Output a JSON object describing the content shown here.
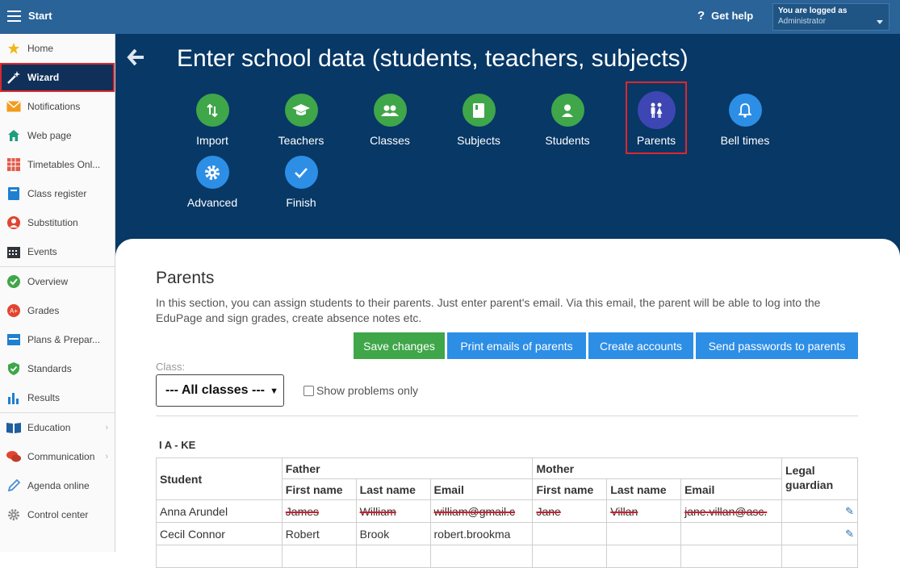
{
  "topbar": {
    "start_label": "Start",
    "help_label": "Get help",
    "logged_in_label": "You are logged as",
    "user_role": "Administrator"
  },
  "sidebar": {
    "items": [
      {
        "label": "Home",
        "icon": "star-icon"
      },
      {
        "label": "Wizard",
        "icon": "magic-wand-icon"
      },
      {
        "label": "Notifications",
        "icon": "envelope-icon"
      },
      {
        "label": "Web page",
        "icon": "house-icon"
      },
      {
        "label": "Timetables Onl...",
        "icon": "timetable-icon"
      },
      {
        "label": "Class register",
        "icon": "book-icon"
      },
      {
        "label": "Substitution",
        "icon": "person-icon"
      },
      {
        "label": "Events",
        "icon": "calendar-icon"
      },
      {
        "label": "Overview",
        "icon": "check-circle-icon"
      },
      {
        "label": "Grades",
        "icon": "grades-icon"
      },
      {
        "label": "Plans & Prepar...",
        "icon": "plans-icon"
      },
      {
        "label": "Standards",
        "icon": "shield-icon"
      },
      {
        "label": "Results",
        "icon": "bar-chart-icon"
      },
      {
        "label": "Education",
        "icon": "open-book-icon"
      },
      {
        "label": "Communication",
        "icon": "chat-icon"
      },
      {
        "label": "Agenda online",
        "icon": "pen-icon"
      },
      {
        "label": "Control center",
        "icon": "gear-icon"
      }
    ]
  },
  "hero": {
    "title": "Enter school data (students, teachers, subjects)",
    "steps": [
      {
        "label": "Import",
        "icon": "import-arrows-icon"
      },
      {
        "label": "Teachers",
        "icon": "graduation-cap-icon"
      },
      {
        "label": "Classes",
        "icon": "group-icon"
      },
      {
        "label": "Subjects",
        "icon": "book-icon"
      },
      {
        "label": "Students",
        "icon": "person-icon"
      },
      {
        "label": "Parents",
        "icon": "parents-icon"
      },
      {
        "label": "Bell times",
        "icon": "bell-icon"
      },
      {
        "label": "Advanced",
        "icon": "gear-icon"
      },
      {
        "label": "Finish",
        "icon": "check-icon"
      }
    ]
  },
  "parents": {
    "title": "Parents",
    "description": "In this section, you can assign students to their parents. Just enter parent's email. Via this email, the parent will be able to log into the EduPage and sign grades, create absence notes etc.",
    "buttons": {
      "save": "Save changes",
      "print": "Print emails of parents",
      "create": "Create accounts",
      "send": "Send passwords to parents"
    },
    "class_label": "Class:",
    "class_selected": "--- All classes ---",
    "show_problems": "Show problems only",
    "class_name": "I A - KE",
    "table": {
      "student_header": "Student",
      "father_header": "Father",
      "mother_header": "Mother",
      "legal_header": "Legal guardian",
      "first_name": "First name",
      "last_name": "Last name",
      "email": "Email",
      "rows": [
        {
          "student": "Anna Arundel",
          "f_first": "James",
          "f_last": "William",
          "f_email": "william@gmail.c",
          "m_first": "Jane",
          "m_last": "Villan",
          "m_email": "jane.villan@asc."
        },
        {
          "student": "Cecil Connor",
          "f_first": "Robert",
          "f_last": "Brook",
          "f_email": "robert.brookma",
          "m_first": "",
          "m_last": "",
          "m_email": ""
        }
      ]
    }
  },
  "colors": {
    "topbar": "#2a6398",
    "hero": "#073866",
    "green": "#3fa649",
    "blue": "#2d8ee6",
    "highlight": "#e0262b"
  }
}
